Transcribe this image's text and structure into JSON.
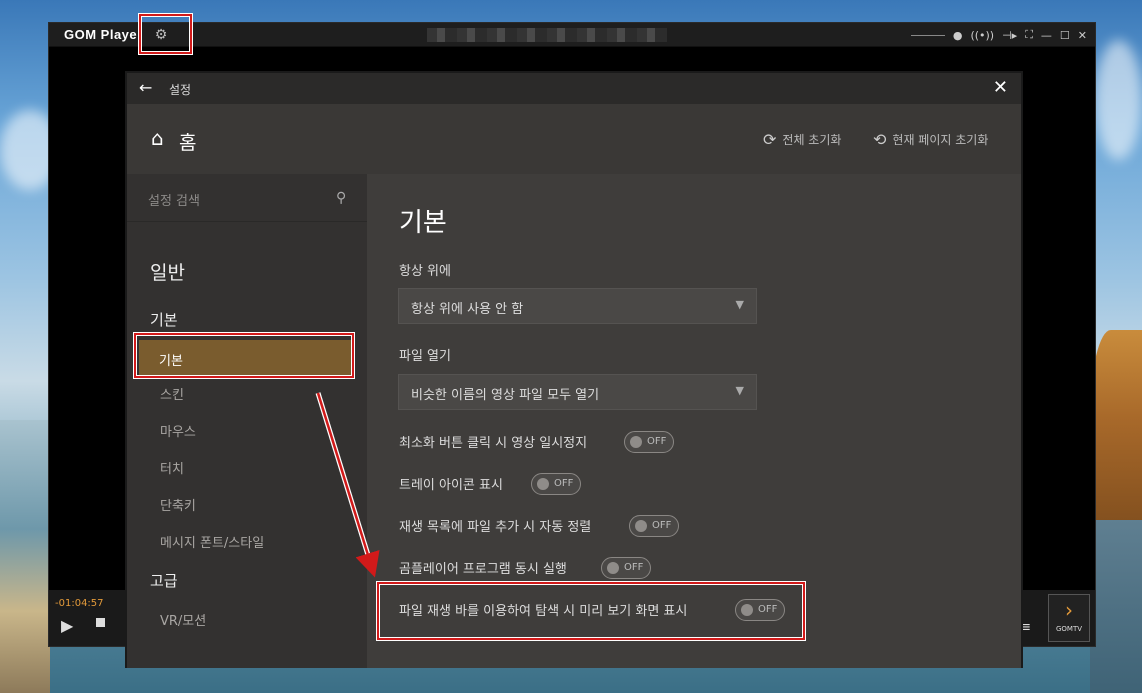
{
  "player": {
    "logo": "GOM Player",
    "time": "-01:04:57",
    "gomtv_label": "GOMTV"
  },
  "settings": {
    "window_title": "설정",
    "home_label": "홈",
    "reset_all_label": "전체 초기화",
    "reset_page_label": "현재 페이지 초기화",
    "search_placeholder": "설정 검색",
    "sidebar": {
      "section_general": "일반",
      "group_basic": "기본",
      "items": [
        "기본",
        "스킨",
        "마우스",
        "터치",
        "단축키",
        "메시지 폰트/스타일"
      ],
      "section_advanced": "고급",
      "advanced_items": [
        "VR/모션"
      ]
    },
    "main": {
      "title": "기본",
      "always_on_top_label": "항상 위에",
      "always_on_top_value": "항상 위에 사용 안 함",
      "open_file_label": "파일 열기",
      "open_file_value": "비슷한 이름의 영상 파일 모두 열기",
      "toggles": [
        {
          "label": "최소화 버튼 클릭 시 영상 일시정지",
          "state": "OFF"
        },
        {
          "label": "트레이 아이콘 표시",
          "state": "OFF"
        },
        {
          "label": "재생 목록에 파일 추가 시 자동 정렬",
          "state": "OFF"
        },
        {
          "label": "곰플레이어 프로그램 동시 실행",
          "state": "OFF"
        },
        {
          "label": "파일 재생 바를 이용하여 탐색 시 미리 보기 화면 표시",
          "state": "OFF"
        }
      ]
    }
  },
  "colors": {
    "accent": "#7a5c2e",
    "highlight": "#d21a1a"
  }
}
